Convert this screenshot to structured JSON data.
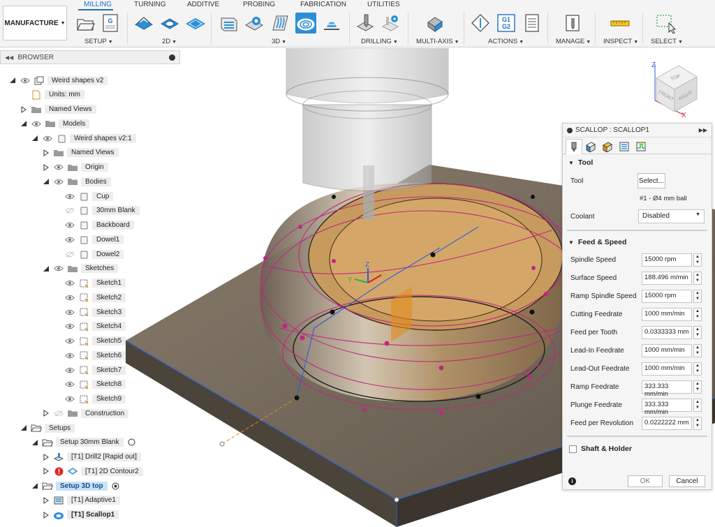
{
  "workspace": {
    "label": "MANUFACTURE"
  },
  "tabs": [
    "MILLING",
    "TURNING",
    "ADDITIVE",
    "PROBING",
    "FABRICATION",
    "UTILITIES"
  ],
  "groups": {
    "setup": "SETUP",
    "2d": "2D",
    "3d": "3D",
    "drilling": "DRILLING",
    "multiaxis": "MULTI-AXIS",
    "actions": "ACTIONS",
    "manage": "MANAGE",
    "inspect": "INSPECT",
    "select": "SELECT"
  },
  "actions_icon_text": {
    "line1": "G1",
    "line2": "G2"
  },
  "browser": {
    "title": "BROWSER",
    "nodes": [
      {
        "label": "Weird shapes v2"
      },
      {
        "label": "Units: mm"
      },
      {
        "label": "Named Views"
      },
      {
        "label": "Models"
      },
      {
        "label": "Weird shapes v2:1"
      },
      {
        "label": "Named Views"
      },
      {
        "label": "Origin"
      },
      {
        "label": "Bodies"
      },
      {
        "label": "Cup"
      },
      {
        "label": "30mm Blank"
      },
      {
        "label": "Backboard"
      },
      {
        "label": "Dowel1"
      },
      {
        "label": "Dowel2"
      },
      {
        "label": "Sketches"
      },
      {
        "label": "Sketch1"
      },
      {
        "label": "Sketch2"
      },
      {
        "label": "Sketch3"
      },
      {
        "label": "Sketch4"
      },
      {
        "label": "Sketch5"
      },
      {
        "label": "Sketch6"
      },
      {
        "label": "Sketch7"
      },
      {
        "label": "Sketch8"
      },
      {
        "label": "Sketch9"
      },
      {
        "label": "Construction"
      },
      {
        "label": "Setups"
      },
      {
        "label": "Setup 30mm Blank"
      },
      {
        "label": "[T1] Drill2 [Rapid out]"
      },
      {
        "label": "[T1] 2D Contour2"
      },
      {
        "label": "Setup 3D top"
      },
      {
        "label": "[T1] Adaptive1"
      },
      {
        "label": "[T1] Scallop1"
      }
    ]
  },
  "viewcube": {
    "top": "TOP",
    "front": "FRONT",
    "right": "RIGHT",
    "axis_z": "Z",
    "axis_x": "X"
  },
  "triad": {
    "axis_z": "Z",
    "axis_y": "Y"
  },
  "panel": {
    "title": "SCALLOP : SCALLOP1",
    "tool_section": "Tool",
    "tool_label": "Tool",
    "tool_button": "Select...",
    "tool_desc": "#1 - Ø4 mm ball",
    "coolant_label": "Coolant",
    "coolant_value": "Disabled",
    "feed_section": "Feed & Speed",
    "feed_rows": [
      {
        "label": "Spindle Speed",
        "value": "15000 rpm"
      },
      {
        "label": "Surface Speed",
        "value": "188.496 m/min"
      },
      {
        "label": "Ramp Spindle Speed",
        "value": "15000 rpm"
      },
      {
        "label": "Cutting Feedrate",
        "value": "1000 mm/min"
      },
      {
        "label": "Feed per Tooth",
        "value": "0.0333333 mm"
      },
      {
        "label": "Lead-In Feedrate",
        "value": "1000 mm/min"
      },
      {
        "label": "Lead-Out Feedrate",
        "value": "1000 mm/min"
      },
      {
        "label": "Ramp Feedrate",
        "value": "333.333 mm/min"
      },
      {
        "label": "Plunge Feedrate",
        "value": "333.333 mm/min"
      },
      {
        "label": "Feed per Revolution",
        "value": "0.0222222 mm"
      }
    ],
    "shaft_label": "Shaft & Holder",
    "ok": "OK",
    "cancel": "Cancel"
  },
  "colors": {
    "accent": "#1f6fc4",
    "active_setup": "#c9e2f7",
    "base": "#6e6457",
    "cup": "#b08a55",
    "path": "#c0277f",
    "error": "#e0262b"
  }
}
